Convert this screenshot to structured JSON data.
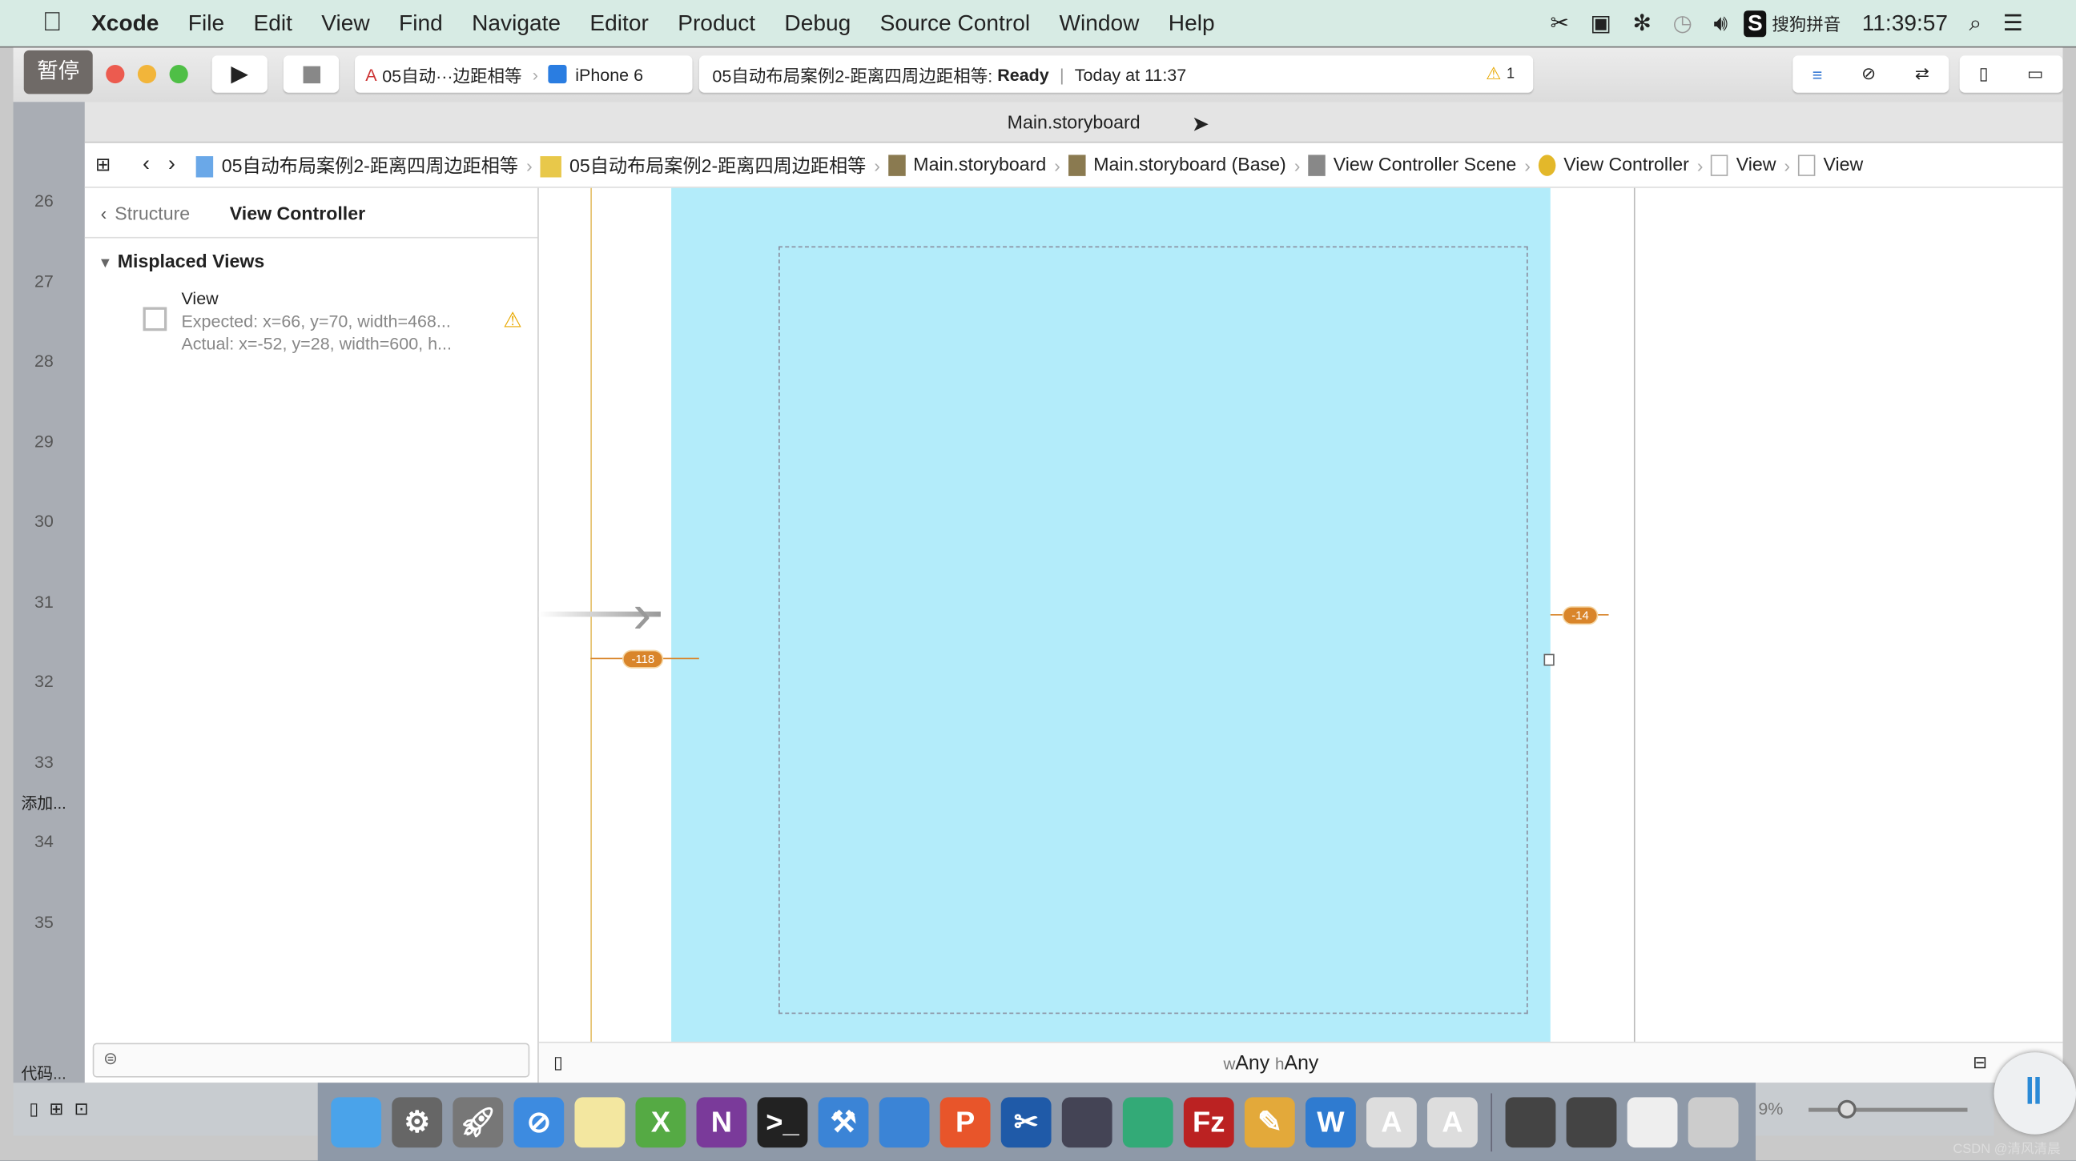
{
  "menubar": {
    "app": "Xcode",
    "items": [
      "File",
      "Edit",
      "View",
      "Find",
      "Navigate",
      "Editor",
      "Product",
      "Debug",
      "Source Control",
      "Window",
      "Help"
    ],
    "input_method": "搜狗拼音",
    "clock": "11:39:57"
  },
  "toolbar": {
    "pause_overlay": "暂停",
    "scheme": "05自动···边距相等",
    "device": "iPhone 6",
    "status_project": "05自动布局案例2-距离四周边距相等:",
    "status_state": "Ready",
    "status_time": "Today at 11:37",
    "warning_count": "1"
  },
  "tab_title": "Main.storyboard",
  "jumpbar": [
    "05自动布局案例2-距离四周边距相等",
    "05自动布局案例2-距离四周边距相等",
    "Main.storyboard",
    "Main.storyboard (Base)",
    "View Controller Scene",
    "View Controller",
    "View",
    "View"
  ],
  "navigator": {
    "back_label": "Structure",
    "title": "View Controller",
    "section": "Misplaced Views",
    "item": {
      "name": "View",
      "expected": "Expected: x=66, y=70, width=468...",
      "actual": "Actual: x=-52, y=28, width=600, h..."
    }
  },
  "left_strip": {
    "line_numbers": [
      "26",
      "27",
      "28",
      "29",
      "30",
      "31",
      "32",
      "33",
      "34",
      "35"
    ],
    "section1": "添加...",
    "section2": "代码..."
  },
  "canvas": {
    "constraint_left": "-118",
    "constraint_right": "-14",
    "size_class_w": "Any",
    "size_class_h": "Any",
    "size_w_prefix": "w",
    "size_h_prefix": "h"
  },
  "zoom_label": "9%",
  "watermark": "CSDN @清风清晨",
  "colors": {
    "view_bg": "#b3ecfa",
    "constraint": "#d9852a"
  }
}
